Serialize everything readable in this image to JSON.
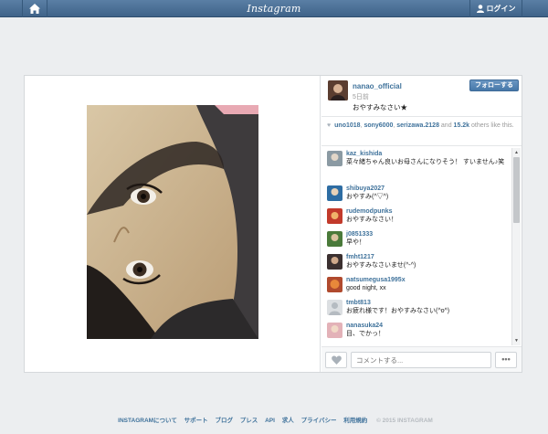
{
  "topbar": {
    "brand": "Instagram",
    "login_label": "ログイン"
  },
  "post": {
    "username": "nanao_official",
    "time": "5日前",
    "caption": "おやすみなさい",
    "follow_label": "フォローする",
    "likes": {
      "users": [
        "uno1018",
        "sony6000",
        "serizawa.2128"
      ],
      "count_text": "15.2k",
      "suffix": "others like this."
    }
  },
  "comments": [
    {
      "user": "kaz_kishida",
      "text": "菜々緒ちゃん良いお母さんになりそう！ すいません♪笑"
    },
    {
      "user": "shibuya2027",
      "text": "おやすみ(^▽^)"
    },
    {
      "user": "rudemodpunks",
      "text": "おやすみなさい！"
    },
    {
      "user": "j0851333",
      "text": "早や！"
    },
    {
      "user": "fmht1217",
      "text": "おやすみなさいませ(^-^)"
    },
    {
      "user": "natsumegusa1995x",
      "text": "good night, xx"
    },
    {
      "user": "tmbt813",
      "text": "お疲れ様です！おやすみなさい(^o^)"
    },
    {
      "user": "nanasuka24",
      "text": "目、でかっ！"
    }
  ],
  "comment_input": {
    "placeholder": "コメントする..."
  },
  "footer": {
    "links": [
      "INSTAGRAMについて",
      "サポート",
      "ブログ",
      "プレス",
      "API",
      "求人",
      "プライバシー",
      "利用規約"
    ],
    "copyright": "© 2015 INSTAGRAM"
  },
  "colors": {
    "link": "#3f729b",
    "topbar": "#4a6f95",
    "follow_button": "#517fa4"
  }
}
